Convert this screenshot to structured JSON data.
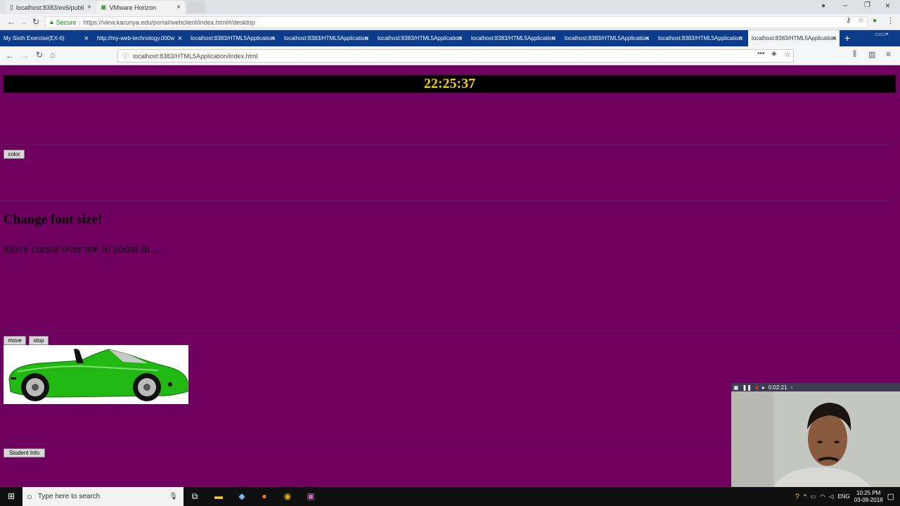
{
  "chrome": {
    "tabs": [
      {
        "label": "localhost:8383/ex6/publi"
      },
      {
        "label": "VMware Horizon"
      }
    ],
    "secure_label": "Secure",
    "url": "https://view.karunya.edu/portal/webclient/index.html#/desktop"
  },
  "firefox": {
    "tabs": [
      {
        "label": "My Sixth Exercise(EX-6)"
      },
      {
        "label": "http://my-web-technology.000w"
      },
      {
        "label": "localhost:8383/HTML5Application"
      },
      {
        "label": "localhost:8383/HTML5Application"
      },
      {
        "label": "localhost:8383/HTML5Application"
      },
      {
        "label": "localhost:8383/HTML5Application"
      },
      {
        "label": "localhost:8383/HTML5Application"
      },
      {
        "label": "localhost:8383/HTML5Application"
      },
      {
        "label": "localhost:8383/HTML5Application"
      }
    ],
    "url": "localhost:8383/HTML5Application/index.html"
  },
  "page": {
    "clock": "22:25:37",
    "color_button": "color",
    "heading": "Change font size!",
    "zoom_text": "move cursor over me to zoom in...",
    "move_button": "move",
    "stop_button": "stop",
    "student_info_button": "Student Info"
  },
  "recorder": {
    "time": "0:02:21"
  },
  "taskbar": {
    "search_placeholder": "Type here to search",
    "language": "ENG",
    "time": "10:25 PM",
    "date": "03-09-2018"
  },
  "colors": {
    "page_bg": "#700060",
    "clock_text": "#f0d000",
    "car_body": "#22b814"
  }
}
